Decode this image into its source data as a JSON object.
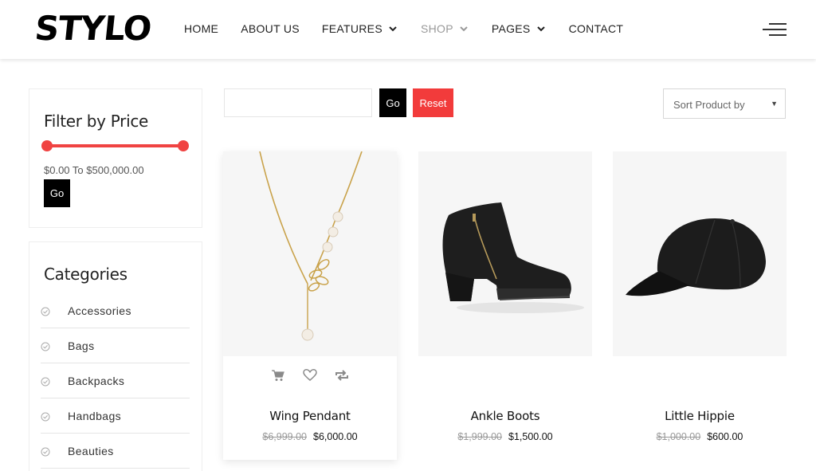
{
  "header": {
    "logo": "STYLO",
    "nav": [
      {
        "label": "HOME",
        "dropdown": false,
        "active": false
      },
      {
        "label": "ABOUT US",
        "dropdown": false,
        "active": false
      },
      {
        "label": "FEATURES",
        "dropdown": true,
        "active": false
      },
      {
        "label": "SHOP",
        "dropdown": true,
        "active": true
      },
      {
        "label": "PAGES",
        "dropdown": true,
        "active": false
      },
      {
        "label": "CONTACT",
        "dropdown": false,
        "active": false
      }
    ]
  },
  "filter_price": {
    "title": "Filter by Price",
    "range_text": "$0.00 To $500,000.00",
    "min_fraction": 0,
    "max_fraction": 1,
    "go_label": "Go"
  },
  "categories": {
    "title": "Categories",
    "items": [
      "Accessories",
      "Bags",
      "Backpacks",
      "Handbags",
      "Beauties"
    ]
  },
  "toolbar": {
    "search_value": "",
    "go_label": "Go",
    "reset_label": "Reset",
    "sort_value": "Sort Product by"
  },
  "products": [
    {
      "name": "Wing Pendant",
      "old_price": "$6,999.00",
      "price": "$6,000.00"
    },
    {
      "name": "Ankle Boots",
      "old_price": "$1,999.00",
      "price": "$1,500.00"
    },
    {
      "name": "Little Hippie",
      "old_price": "$1,000.00",
      "price": "$600.00"
    }
  ],
  "colors": {
    "accent": "#f23b3b",
    "dark": "#000000",
    "image_bg": "#f6f6f6"
  },
  "icons": {
    "product_actions": [
      "cart-icon",
      "heart-icon",
      "compare-icon"
    ],
    "category_marker": "check-circle-icon"
  }
}
